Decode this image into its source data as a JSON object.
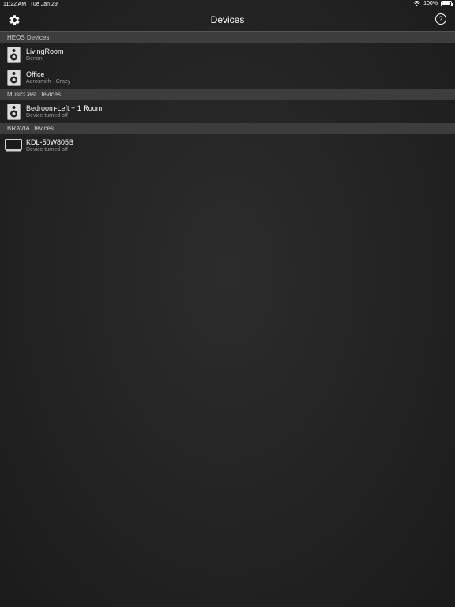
{
  "status_bar": {
    "time": "11:22 AM",
    "date": "Tue Jan 29",
    "battery": "100%"
  },
  "nav": {
    "title": "Devices",
    "help_label": "?"
  },
  "sections": [
    {
      "title": "HEOS Devices",
      "devices": [
        {
          "name": "LivingRoom",
          "subtitle": "Denon",
          "icon": "speaker-icon"
        },
        {
          "name": "Office",
          "subtitle": "Aerosmith - Crazy",
          "icon": "speaker-icon"
        }
      ]
    },
    {
      "title": "MusicCast Devices",
      "devices": [
        {
          "name": "Bedroom-Left + 1 Room",
          "subtitle": "Device turned off",
          "icon": "speaker-icon"
        }
      ]
    },
    {
      "title": "BRAVIA Devices",
      "devices": [
        {
          "name": "KDL-50W805B",
          "subtitle": "Device turned off",
          "icon": "tv-icon"
        }
      ]
    }
  ]
}
